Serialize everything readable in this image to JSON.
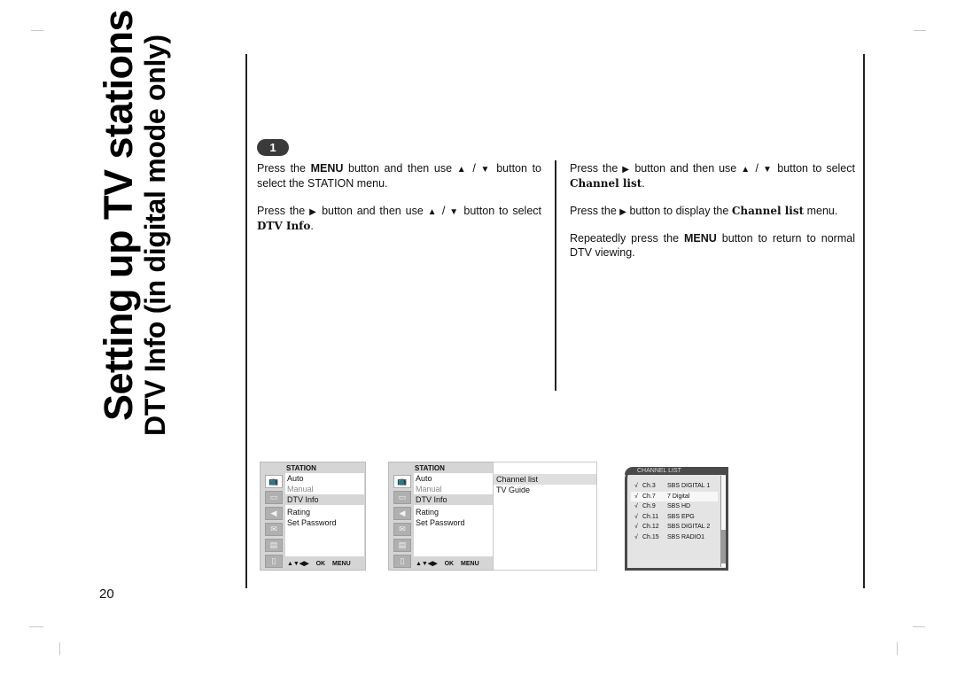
{
  "page": {
    "title_main": "Setting up TV stations",
    "title_sub": "DTV Info (in digital mode only)",
    "page_number": "20"
  },
  "step": {
    "badge": "1"
  },
  "left_column": {
    "p1": {
      "a": "Press the ",
      "b": "MENU",
      "c": " button and then use ",
      "up": "▲",
      "sep": " / ",
      "down": "▼",
      "d": " button to select the STATION menu."
    },
    "p2": {
      "a": "Press the ",
      "right": "▶",
      "b": " button and then use ",
      "up": "▲",
      "sep": " / ",
      "down": "▼",
      "c": " button to select ",
      "d": "DTV Info",
      "e": "."
    }
  },
  "right_column": {
    "p1": {
      "a": "Press the ",
      "right": "▶",
      "b": " button and then use ",
      "up": "▲",
      "sep": " / ",
      "down": "▼",
      "c": " button to select ",
      "d": "Channel list",
      "e": "."
    },
    "p2": {
      "a": "Press the ",
      "right": "▶",
      "b": " button to display the ",
      "c": "Channel list",
      "d": " menu."
    },
    "p3": {
      "a": "Repeatedly press the ",
      "b": "MENU",
      "c": " button to return to normal DTV viewing."
    }
  },
  "osd_menu": {
    "header": "STATION",
    "icons": [
      "station-icon",
      "picture-icon",
      "sound-icon",
      "time-icon",
      "option-icon",
      "lock-icon"
    ],
    "items": [
      {
        "label": "Auto",
        "state": "normal"
      },
      {
        "label": "Manual",
        "state": "dim"
      },
      {
        "label": "DTV Info",
        "state": "selected"
      },
      {
        "label": "Rating",
        "state": "normal"
      },
      {
        "label": "Set Password",
        "state": "normal"
      }
    ],
    "footer": {
      "nav": "▲▼◀▶",
      "ok": "OK",
      "menu": "MENU"
    }
  },
  "submenu": {
    "items": [
      {
        "label": "Channel list",
        "state": "selected"
      },
      {
        "label": "TV Guide",
        "state": "normal"
      }
    ]
  },
  "channel_list": {
    "caption": "CHANNEL LIST",
    "rows": [
      {
        "check": "√",
        "channel": "Ch.3",
        "name": "SBS DIGITAL 1",
        "selected": false
      },
      {
        "check": "√",
        "channel": "Ch.7",
        "name": "7 Digital",
        "selected": true
      },
      {
        "check": "√",
        "channel": "Ch.9",
        "name": "SBS HD",
        "selected": false
      },
      {
        "check": "√",
        "channel": "Ch.11",
        "name": "SBS EPG",
        "selected": false
      },
      {
        "check": "√",
        "channel": "Ch.12",
        "name": "SBS DIGITAL 2",
        "selected": false
      },
      {
        "check": "√",
        "channel": "Ch.15",
        "name": "SBS RADIO1",
        "selected": false
      }
    ]
  }
}
